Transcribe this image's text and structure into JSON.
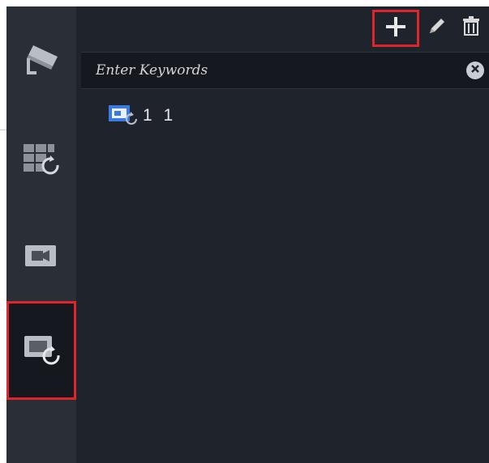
{
  "sidebar": {
    "items": [
      {
        "name": "camera",
        "icon": "security-camera-icon",
        "selected": false
      },
      {
        "name": "view-playback",
        "icon": "grid-playback-icon",
        "selected": false
      },
      {
        "name": "video",
        "icon": "video-camera-icon",
        "selected": false
      },
      {
        "name": "playback",
        "icon": "window-playback-icon",
        "selected": true
      }
    ]
  },
  "toolbar": {
    "add_icon": "plus-icon",
    "edit_icon": "pencil-icon",
    "delete_icon": "trash-icon"
  },
  "search": {
    "placeholder": "Enter Keywords",
    "value": ""
  },
  "tree": {
    "items": [
      {
        "label": "1 1",
        "icon": "playback-view-icon"
      }
    ]
  },
  "colors": {
    "highlight": "#e0242b",
    "accent_blue": "#3b7be0",
    "panel_bg": "#1f232b",
    "sidebar_bg": "#2a2e37"
  }
}
